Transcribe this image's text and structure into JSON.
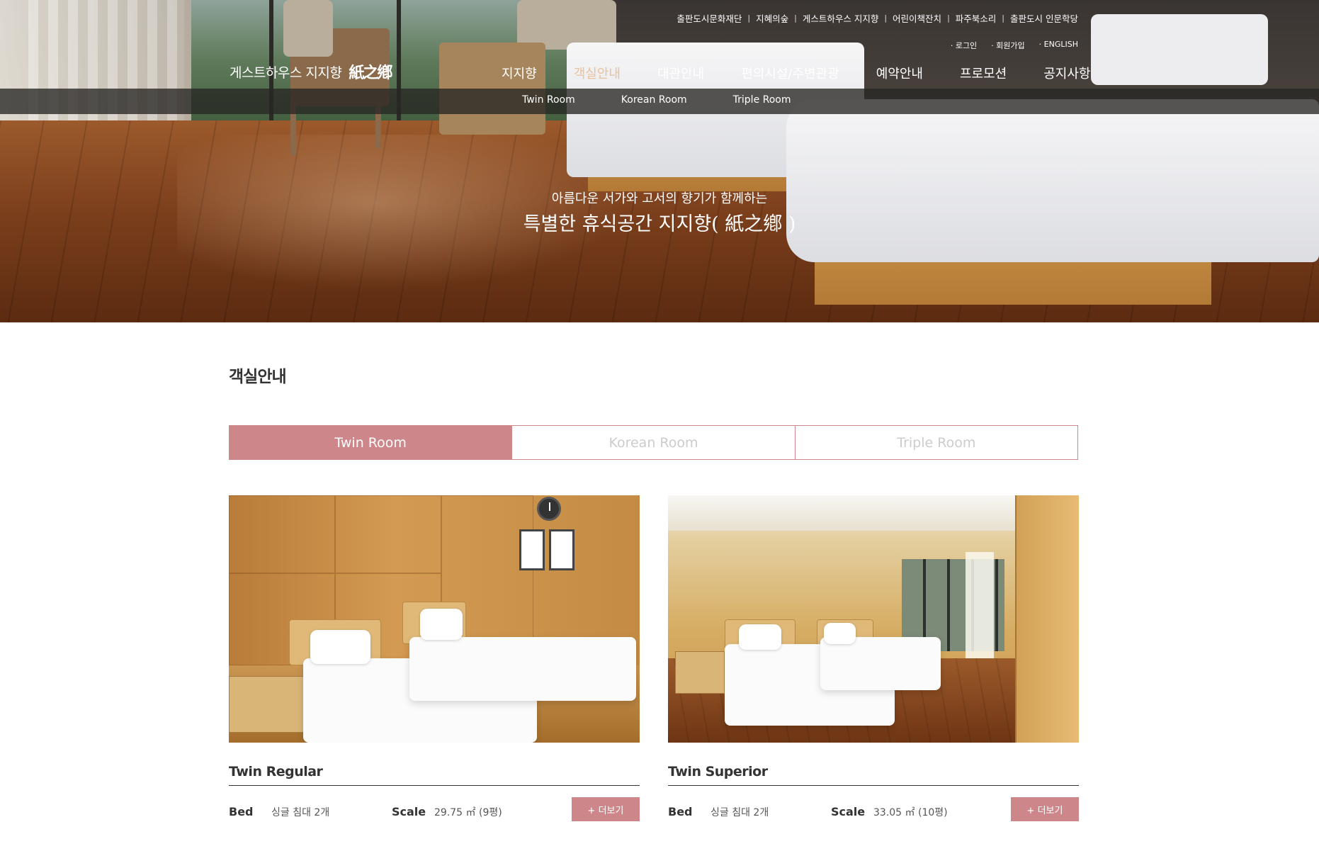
{
  "top_links": [
    "출판도시문화재단",
    "지혜의숲",
    "게스트하우스 지지향",
    "어린이책잔치",
    "파주북소리",
    "출판도시 인문학당"
  ],
  "member_links": [
    "· 로그인",
    "· 회원가입",
    "· ENGLISH"
  ],
  "logo": {
    "text": "게스트하우스 지지향",
    "mark": "紙之鄕"
  },
  "main_nav": [
    "지지향",
    "객실안내",
    "대관안내",
    "편의시설/주변관광",
    "예약안내",
    "프로모션",
    "공지사항"
  ],
  "main_nav_active": "객실안내",
  "sub_nav": [
    "Twin Room",
    "Korean Room",
    "Triple Room"
  ],
  "hero": {
    "line1": "아름다운 서가와 고서의 향기가 함께하는",
    "line2": "특별한 휴식공간 지지향( 紙之鄕 )"
  },
  "page_title": "객실안내",
  "tabs": [
    {
      "label": "Twin Room",
      "active": true
    },
    {
      "label": "Korean Room",
      "active": false
    },
    {
      "label": "Triple Room",
      "active": false
    }
  ],
  "rooms": [
    {
      "name": "Twin Regular",
      "bed_label": "Bed",
      "bed": "싱글 침대 2개",
      "scale_label": "Scale",
      "scale": "29.75 ㎡ (9평)",
      "more": "+ 더보기"
    },
    {
      "name": "Twin Superior",
      "bed_label": "Bed",
      "bed": "싱글 침대 2개",
      "scale_label": "Scale",
      "scale": "33.05 ㎡ (10평)",
      "more": "+ 더보기"
    }
  ],
  "colors": {
    "accent": "#cd878a",
    "nav_active": "#e8c29f",
    "text": "#333333"
  }
}
